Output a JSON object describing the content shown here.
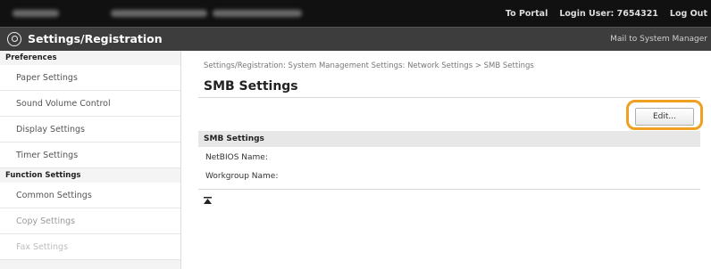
{
  "topbar": {
    "to_portal": "To Portal",
    "login_user": "Login User: 7654321",
    "log_out": "Log Out"
  },
  "titlebar": {
    "title": "Settings/Registration",
    "mailto": "Mail to System Manager"
  },
  "sidebar": {
    "preferences_heading": "Preferences",
    "preferences_items": [
      {
        "label": "Paper Settings"
      },
      {
        "label": "Sound Volume Control"
      },
      {
        "label": "Display Settings"
      },
      {
        "label": "Timer Settings"
      }
    ],
    "function_heading": "Function Settings",
    "function_items": [
      {
        "label": "Common Settings"
      },
      {
        "label": "Copy Settings"
      },
      {
        "label": "Fax Settings"
      }
    ]
  },
  "main": {
    "breadcrumb": "Settings/Registration: System Management Settings: Network Settings > SMB Settings",
    "title": "SMB Settings",
    "edit_label": "Edit...",
    "section_heading": "SMB Settings",
    "fields": [
      {
        "label": "NetBIOS Name:"
      },
      {
        "label": "Workgroup Name:"
      }
    ]
  },
  "icons": {
    "app": "settings-registration-icon",
    "back_to_top": "back-to-top-icon"
  },
  "colors": {
    "topbar": "#111111",
    "titlebar": "#3d3d3d",
    "highlight": "#f0a020"
  }
}
